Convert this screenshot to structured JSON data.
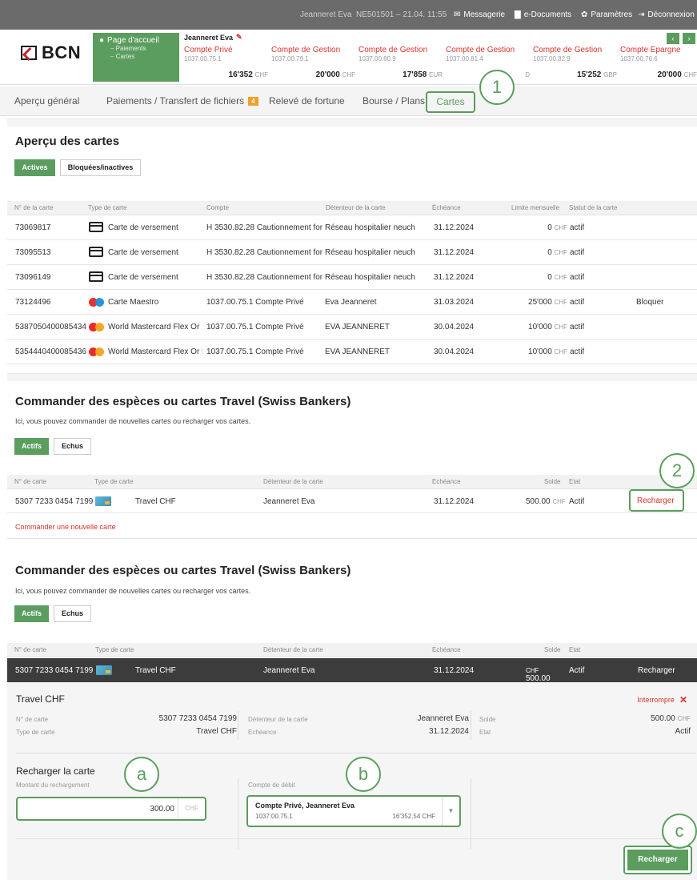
{
  "topbar": {
    "user": "Jeanneret Eva",
    "session": "NE501501 – 21.04. 11:55",
    "messagerie": "Messagerie",
    "edocuments": "e-Documents",
    "parametres": "Paramètres",
    "deconnexion": "Déconnexion"
  },
  "header": {
    "logo": "BCN",
    "home": {
      "title": "Page d'accueil",
      "sub1": "– Paiements",
      "sub2": "– Cartes"
    },
    "user_label": "Jeanneret Eva",
    "accounts": [
      {
        "name": "Compte Privé",
        "num": "1037.00.75.1",
        "bal": "16'352",
        "cur": "CHF"
      },
      {
        "name": "Compte de Gestion",
        "num": "1037.00.79.1",
        "bal": "20'000",
        "cur": "CHF"
      },
      {
        "name": "Compte de Gestion",
        "num": "1037.00.80.9",
        "bal": "17'858",
        "cur": "EUR"
      },
      {
        "name": "Compte de Gestion",
        "num": "1037.00.81.4",
        "bal": "",
        "cur": "D"
      },
      {
        "name": "Compte de Gestion",
        "num": "1037.00.82.9",
        "bal": "15'252",
        "cur": "GBP"
      },
      {
        "name": "Compte Epargne",
        "num": "1037.00.76.6",
        "bal": "20'000",
        "cur": "CHF"
      }
    ],
    "nav_prev": "‹",
    "nav_next": "›"
  },
  "nav": {
    "apercu": "Aperçu général",
    "paiements": "Paiements / Transfert de fichiers",
    "paiements_badge": "4",
    "releve": "Relevé de fortune",
    "bourse": "Bourse / Plans",
    "cartes": "Cartes"
  },
  "callouts": {
    "one": "1",
    "two": "2",
    "a": "a",
    "b": "b",
    "c": "c"
  },
  "cards_overview": {
    "title": "Aperçu des cartes",
    "tab_active": "Actives",
    "tab_blocked": "Bloquées/inactives",
    "headers": [
      "N° de la carte",
      "Type de carte",
      "Compte",
      "Détenteur de la carte",
      "Échéance",
      "Limite mensuelle",
      "Statut de la carte"
    ],
    "rows": [
      {
        "num": "73069817",
        "type": "Carte de versement",
        "icon": "card",
        "compte": "H 3530.82.28 Cautionnement fon",
        "holder": "Réseau hospitalier neuch",
        "due": "31.12.2024",
        "limit": "0",
        "cur": "CHF",
        "status": "actif",
        "action": ""
      },
      {
        "num": "73095513",
        "type": "Carte de versement",
        "icon": "card",
        "compte": "H 3530.82.28 Cautionnement fon",
        "holder": "Réseau hospitalier neuch",
        "due": "31.12.2024",
        "limit": "0",
        "cur": "CHF",
        "status": "actif",
        "action": ""
      },
      {
        "num": "73096149",
        "type": "Carte de versement",
        "icon": "card",
        "compte": "H 3530.82.28 Cautionnement fon",
        "holder": "Réseau hospitalier neuch",
        "due": "31.12.2024",
        "limit": "0",
        "cur": "CHF",
        "status": "actif",
        "action": ""
      },
      {
        "num": "73124496",
        "type": "Carte Maestro",
        "icon": "maestro",
        "compte": "1037.00.75.1 Compte Privé",
        "holder": "Eva Jeanneret",
        "due": "31.03.2024",
        "limit": "25'000",
        "cur": "CHF",
        "status": "actif",
        "action": "Bloquer"
      },
      {
        "num": "5387050400085434",
        "type": "World Mastercard Flex Or",
        "icon": "mastercard",
        "compte": "1037.00.75.1 Compte Privé",
        "holder": "EVA JEANNERET",
        "due": "30.04.2024",
        "limit": "10'000",
        "cur": "CHF",
        "status": "actif",
        "action": ""
      },
      {
        "num": "5354440400085436",
        "type": "World Mastercard Flex Or D",
        "icon": "mastercard",
        "compte": "1037.00.75.1 Compte Privé",
        "holder": "EVA JEANNERET",
        "due": "30.04.2024",
        "limit": "10'000",
        "cur": "CHF",
        "status": "actif",
        "action": ""
      }
    ]
  },
  "travel1": {
    "title": "Commander des espèces ou cartes Travel (Swiss Bankers)",
    "subtitle": "Ici, vous pouvez commander de nouvelles cartes ou recharger vos cartes.",
    "tab_active": "Actifs",
    "tab_expired": "Echus",
    "headers": [
      "N° de carte",
      "Type de carte",
      "Détenteur de la carte",
      "Echéance",
      "Solde",
      "Etat"
    ],
    "row": {
      "num": "5307 7233 0454 7199",
      "type": "Travel CHF",
      "holder": "Jeanneret Eva",
      "due": "31.12.2024",
      "balance": "500.00",
      "cur": "CHF",
      "status": "Actif",
      "action": "Recharger"
    },
    "new_card_link": "Commander une nouvelle carte"
  },
  "travel2": {
    "title": "Commander des espèces ou cartes Travel (Swiss Bankers)",
    "subtitle": "Ici, vous pouvez commander de nouvelles cartes ou recharger vos cartes.",
    "tab_active": "Actifs",
    "tab_expired": "Echus",
    "headers": [
      "N° de carte",
      "Type de carte",
      "Détenteur de la carte",
      "Echéance",
      "Solde",
      "Etat"
    ],
    "row": {
      "num": "5307 7233 0454 7199",
      "type": "Travel CHF",
      "holder": "Jeanneret Eva",
      "due": "31.12.2024",
      "balance": "500.00",
      "cur": "CHF",
      "status": "Actif",
      "action": "Recharger"
    },
    "detail": {
      "title": "Travel CHF",
      "interrupt": "Interrompre",
      "lbl_num": "N° de carte",
      "val_num": "5307 7233 0454 7199",
      "lbl_type": "Type de carte",
      "val_type": "Travel CHF",
      "lbl_holder": "Détenteur de la carte",
      "val_holder": "Jeanneret Eva",
      "lbl_due": "Echéance",
      "val_due": "31.12.2024",
      "lbl_balance": "Solde",
      "val_balance": "500.00",
      "val_balance_cur": "CHF",
      "lbl_status": "Etat",
      "val_status": "Actif"
    },
    "recharge": {
      "title": "Recharger la carte",
      "amount_label": "Montant du rechargement",
      "amount_value": "300.00",
      "amount_cur": "CHF",
      "debit_label": "Compte de débit",
      "debit_name": "Compte Privé, Jeanneret Eva",
      "debit_num": "1037.00.75.1",
      "debit_balance": "16'352.54 CHF",
      "submit": "Recharger"
    }
  }
}
